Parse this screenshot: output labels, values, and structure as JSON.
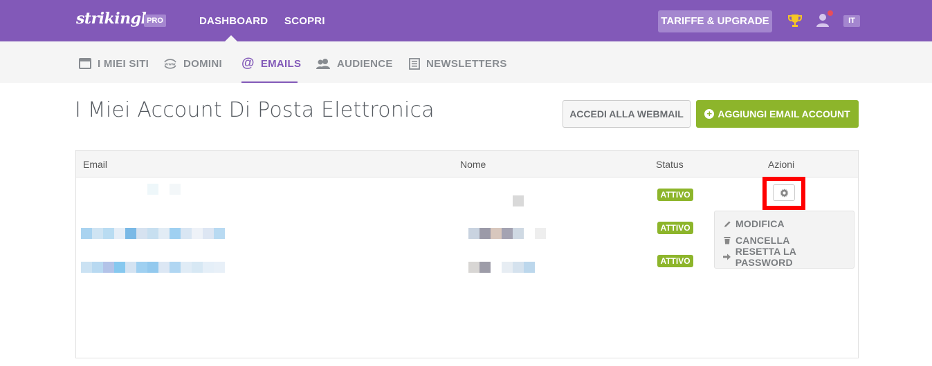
{
  "header": {
    "logo": "strikingly",
    "pro_badge": "PRO",
    "nav": {
      "dashboard": "DASHBOARD",
      "scopri": "SCOPRI"
    },
    "upgrade": "TARIFFE & UPGRADE",
    "language": "IT"
  },
  "subnav": {
    "siti": "I MIEI SITI",
    "domini": "DOMINI",
    "emails": "EMAILS",
    "audience": "AUDIENCE",
    "newsletters": "NEWSLETTERS"
  },
  "page": {
    "title": "I Miei Account Di Posta Elettronica",
    "webmail_button": "ACCEDI ALLA WEBMAIL",
    "add_button": "AGGIUNGI EMAIL ACCOUNT"
  },
  "table": {
    "headers": {
      "email": "Email",
      "nome": "Nome",
      "status": "Status",
      "azioni": "Azioni"
    },
    "rows": [
      {
        "status": "ATTIVO"
      },
      {
        "status": "ATTIVO"
      },
      {
        "status": "ATTIVO"
      }
    ]
  },
  "actions_menu": {
    "modifica": "MODIFICA",
    "cancella": "CANCELLA",
    "reset": "RESETTA LA PASSWORD"
  },
  "colors": {
    "brand_purple": "#8259b8",
    "accent_green": "#8db52b",
    "highlight_red": "#ff0000"
  }
}
